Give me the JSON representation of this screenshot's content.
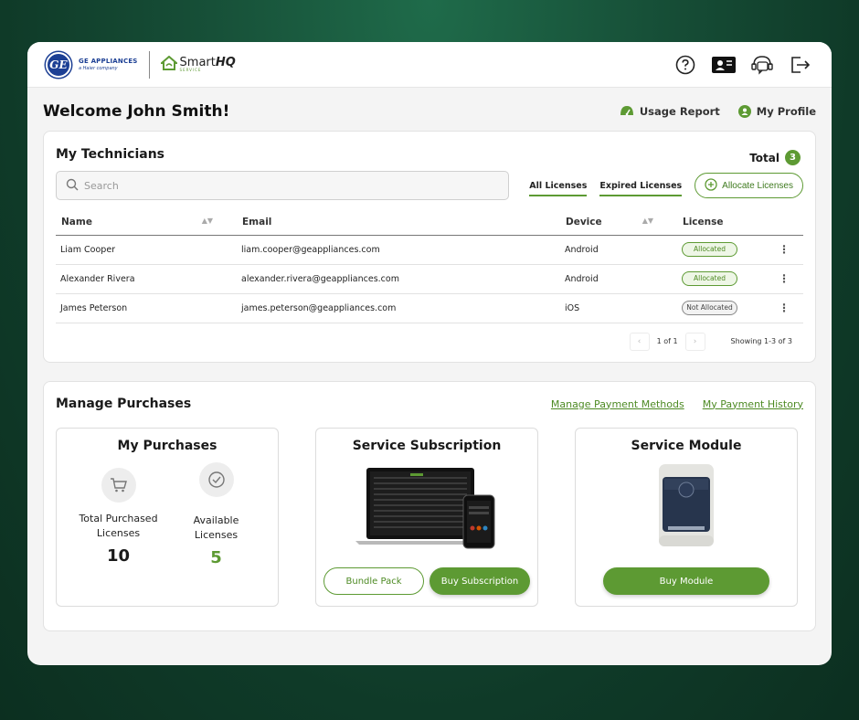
{
  "brand": {
    "ge_line1": "GE APPLIANCES",
    "ge_line2": "a Haier company",
    "ge_mark": "GE",
    "smarthq_name": "Smart",
    "smarthq_bold": "HQ",
    "smarthq_sub": "SERVICE"
  },
  "topbar_icons": [
    "help-icon",
    "contact-card-icon",
    "support-chat-icon",
    "logout-icon"
  ],
  "welcome": {
    "title": "Welcome John Smith!",
    "usage_report": "Usage Report",
    "my_profile": "My Profile"
  },
  "technicians": {
    "title": "My Technicians",
    "total_label": "Total",
    "total_count": "3",
    "search_placeholder": "Search",
    "filter_all": "All Licenses",
    "filter_expired": "Expired Licenses",
    "allocate_label": "Allocate Licenses",
    "columns": [
      "Name",
      "Email",
      "Device",
      "License"
    ],
    "rows": [
      {
        "name": "Liam Cooper",
        "email": "liam.cooper@geappliances.com",
        "device": "Android",
        "license": "Allocated"
      },
      {
        "name": "Alexander Rivera",
        "email": "alexander.rivera@geappliances.com",
        "device": "Android",
        "license": "Allocated"
      },
      {
        "name": "James Peterson",
        "email": "james.peterson@geappliances.com",
        "device": "iOS",
        "license": "Not Allocated"
      }
    ],
    "pager": {
      "page": "1 of 1",
      "showing": "Showing  1-3 of 3",
      "prev": "‹",
      "next": "›"
    }
  },
  "purchases": {
    "title": "Manage Purchases",
    "link_payment_methods": "Manage Payment Methods",
    "link_payment_history": "My Payment History",
    "my_purchases": {
      "title": "My Purchases",
      "total_label": "Total Purchased Licenses",
      "total_value": "10",
      "available_label": "Available Licenses",
      "available_value": "5"
    },
    "subscription": {
      "title": "Service Subscription",
      "bundle_label": "Bundle Pack",
      "buy_label": "Buy Subscription"
    },
    "module": {
      "title": "Service Module",
      "buy_label": "Buy Module"
    }
  },
  "colors": {
    "accent": "#5d9a33",
    "ge_blue": "#1c3f94"
  }
}
